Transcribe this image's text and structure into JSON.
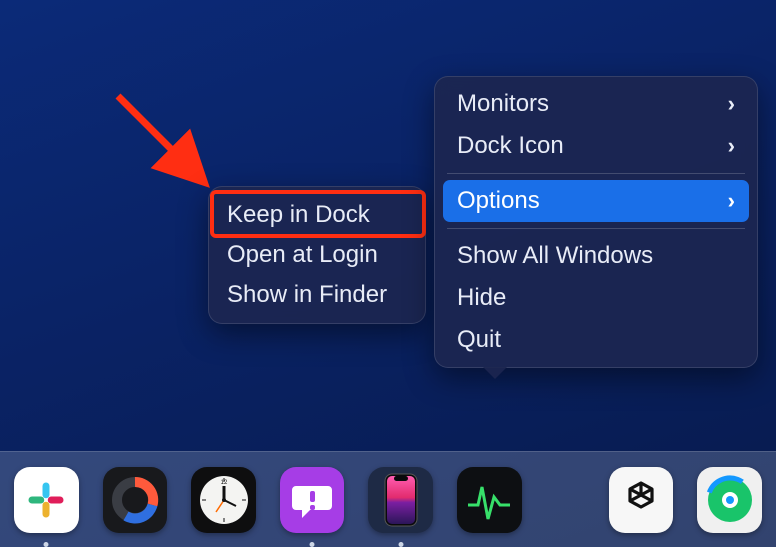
{
  "annotation": {
    "highlight_target": "keep-in-dock"
  },
  "main_menu": {
    "items": [
      {
        "label": "Monitors",
        "has_submenu": true
      },
      {
        "label": "Dock Icon",
        "has_submenu": true
      }
    ],
    "options": {
      "label": "Options",
      "has_submenu": true,
      "selected": true
    },
    "actions": [
      {
        "label": "Show All Windows"
      },
      {
        "label": "Hide"
      },
      {
        "label": "Quit"
      }
    ]
  },
  "options_submenu": {
    "items": [
      {
        "label": "Keep in Dock"
      },
      {
        "label": "Open at Login"
      },
      {
        "label": "Show in Finder"
      }
    ]
  },
  "dock": {
    "items": [
      {
        "name": "slack",
        "running": true
      },
      {
        "name": "donut",
        "running": false
      },
      {
        "name": "clock",
        "running": false
      },
      {
        "name": "feedback",
        "running": true
      },
      {
        "name": "mirroring",
        "running": true
      },
      {
        "name": "activity",
        "running": false
      },
      {
        "name": "openai",
        "running": false
      },
      {
        "name": "findmy",
        "running": false
      }
    ]
  }
}
